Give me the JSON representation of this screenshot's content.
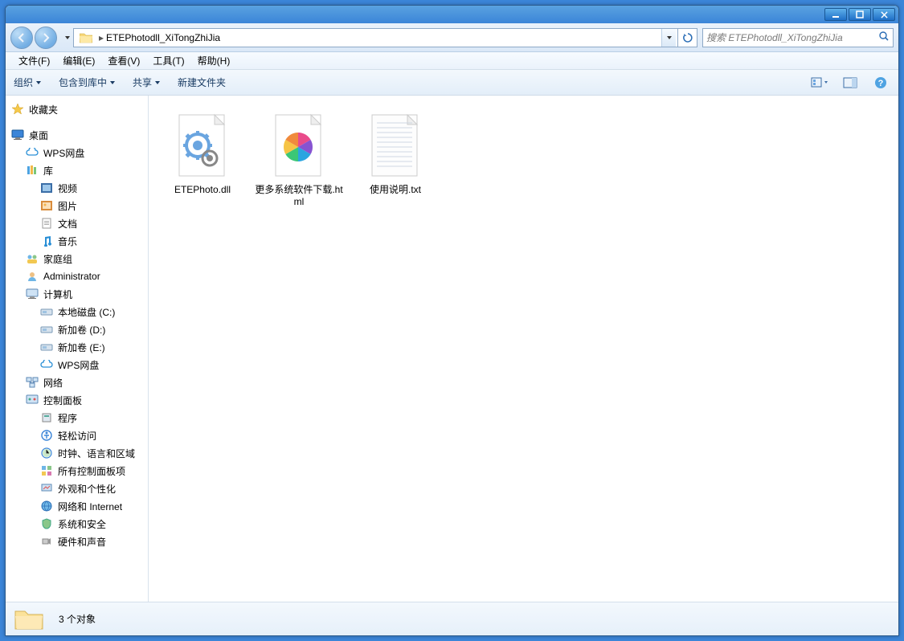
{
  "address": {
    "path": "ETEPhotodll_XiTongZhiJia"
  },
  "search": {
    "placeholder": "搜索 ETEPhotodll_XiTongZhiJia"
  },
  "menubar": [
    {
      "label": "文件(F)"
    },
    {
      "label": "编辑(E)"
    },
    {
      "label": "查看(V)"
    },
    {
      "label": "工具(T)"
    },
    {
      "label": "帮助(H)"
    }
  ],
  "toolbar": {
    "organize": "组织",
    "include": "包含到库中",
    "share": "共享",
    "newfolder": "新建文件夹"
  },
  "sidebar": {
    "favorites": "收藏夹",
    "desktop": "桌面",
    "wps": "WPS网盘",
    "library": "库",
    "video": "视频",
    "pictures": "图片",
    "documents": "文档",
    "music": "音乐",
    "homegroup": "家庭组",
    "admin": "Administrator",
    "computer": "计算机",
    "diskc": "本地磁盘 (C:)",
    "diskd": "新加卷 (D:)",
    "diske": "新加卷 (E:)",
    "wps2": "WPS网盘",
    "network": "网络",
    "controlpanel": "控制面板",
    "programs": "程序",
    "ease": "轻松访问",
    "clock": "时钟、语言和区域",
    "allcp": "所有控制面板项",
    "appearance": "外观和个性化",
    "netint": "网络和 Internet",
    "security": "系统和安全",
    "hwsound": "硬件和声音"
  },
  "files": [
    {
      "name": "ETEPhoto.dll",
      "type": "dll"
    },
    {
      "name": "更多系统软件下载.html",
      "type": "html"
    },
    {
      "name": "使用说明.txt",
      "type": "txt"
    }
  ],
  "status": {
    "text": "3 个对象"
  }
}
